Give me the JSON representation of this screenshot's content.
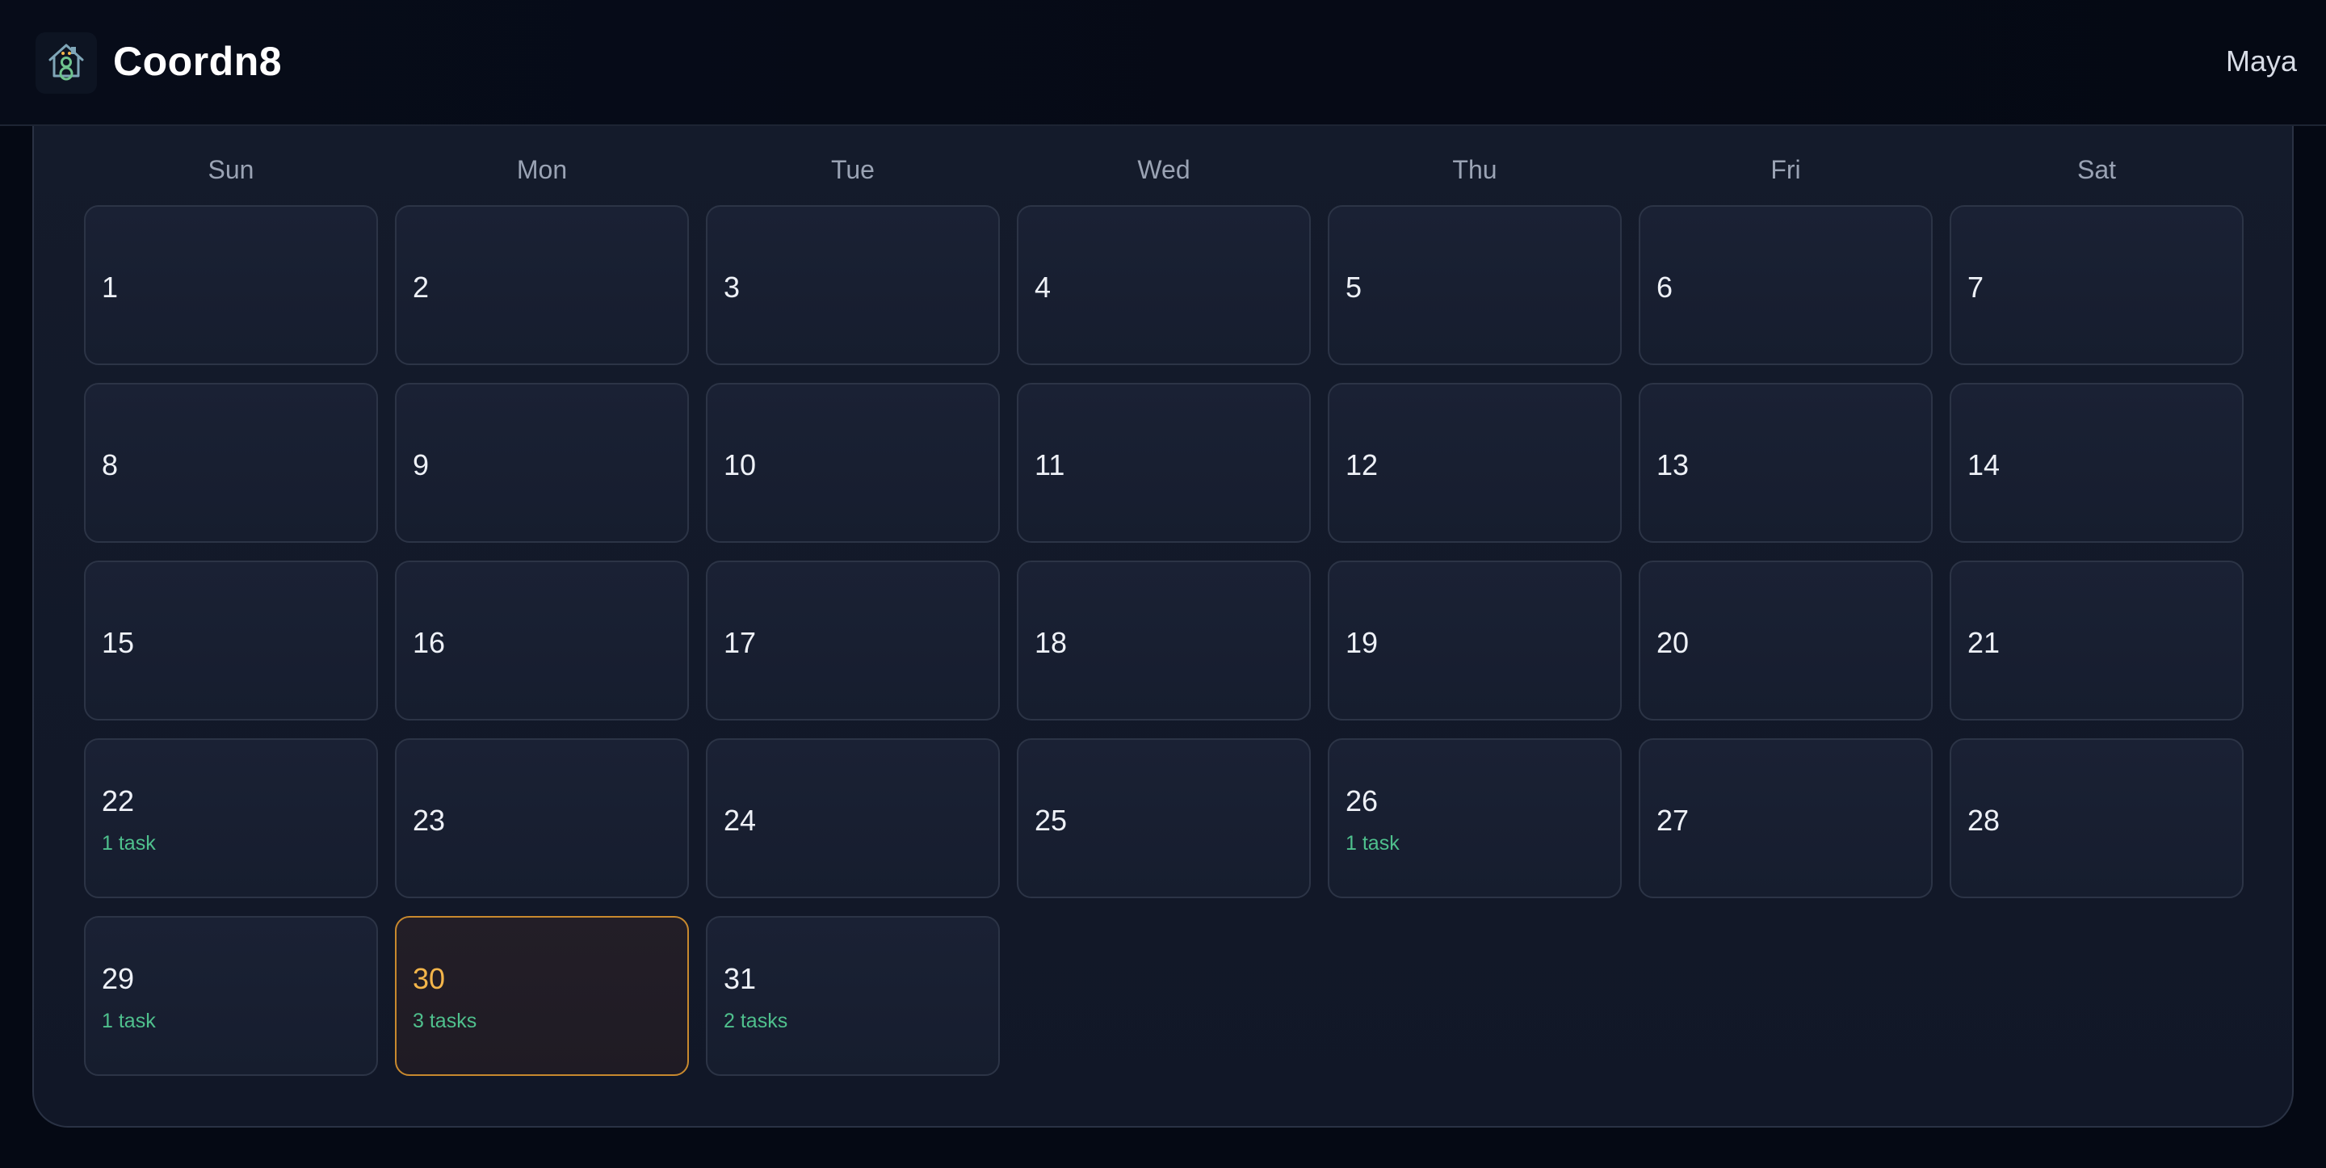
{
  "header": {
    "app_title": "Coordn8",
    "user_name": "Maya",
    "logo_icon": "house-key-logo-icon"
  },
  "calendar": {
    "weekdays": [
      "Sun",
      "Mon",
      "Tue",
      "Wed",
      "Thu",
      "Fri",
      "Sat"
    ],
    "days": [
      {
        "label": "1",
        "tasks": ""
      },
      {
        "label": "2",
        "tasks": ""
      },
      {
        "label": "3",
        "tasks": ""
      },
      {
        "label": "4",
        "tasks": ""
      },
      {
        "label": "5",
        "tasks": ""
      },
      {
        "label": "6",
        "tasks": ""
      },
      {
        "label": "7",
        "tasks": ""
      },
      {
        "label": "8",
        "tasks": ""
      },
      {
        "label": "9",
        "tasks": ""
      },
      {
        "label": "10",
        "tasks": ""
      },
      {
        "label": "11",
        "tasks": ""
      },
      {
        "label": "12",
        "tasks": ""
      },
      {
        "label": "13",
        "tasks": ""
      },
      {
        "label": "14",
        "tasks": ""
      },
      {
        "label": "15",
        "tasks": ""
      },
      {
        "label": "16",
        "tasks": ""
      },
      {
        "label": "17",
        "tasks": ""
      },
      {
        "label": "18",
        "tasks": ""
      },
      {
        "label": "19",
        "tasks": ""
      },
      {
        "label": "20",
        "tasks": ""
      },
      {
        "label": "21",
        "tasks": ""
      },
      {
        "label": "22",
        "tasks": "1 task"
      },
      {
        "label": "23",
        "tasks": ""
      },
      {
        "label": "24",
        "tasks": ""
      },
      {
        "label": "25",
        "tasks": ""
      },
      {
        "label": "26",
        "tasks": "1 task"
      },
      {
        "label": "27",
        "tasks": ""
      },
      {
        "label": "28",
        "tasks": ""
      },
      {
        "label": "29",
        "tasks": "1 task"
      },
      {
        "label": "30",
        "tasks": "3 tasks",
        "today": true
      },
      {
        "label": "31",
        "tasks": "2 tasks"
      }
    ]
  },
  "colors": {
    "background": "#050914",
    "panel": "#141b2b",
    "cell_border": "#2c3446",
    "today_accent": "#f3b54a",
    "today_border": "#c8892e",
    "task_green": "#4fc08d"
  }
}
